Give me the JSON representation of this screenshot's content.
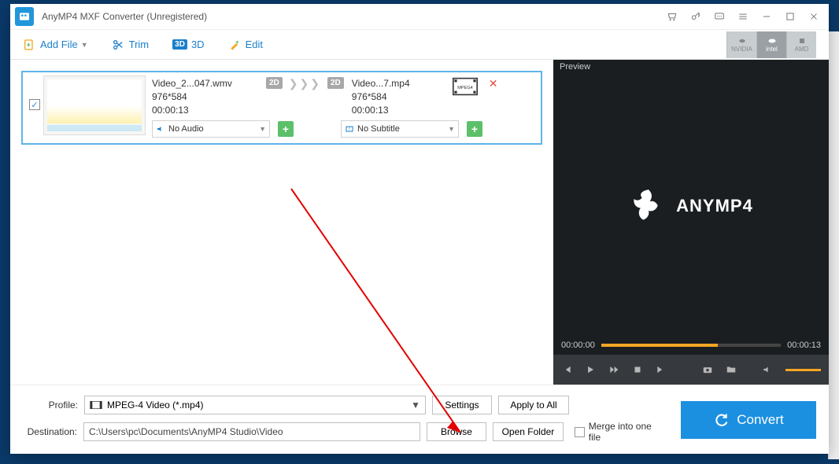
{
  "window": {
    "title": "AnyMP4 MXF Converter (Unregistered)"
  },
  "toolbar": {
    "add_file": "Add File",
    "trim": "Trim",
    "threeD": "3D",
    "edit": "Edit"
  },
  "gpu": {
    "nvidia": "NVIDIA",
    "intel": "intel",
    "amd": "AMD"
  },
  "item": {
    "source": {
      "name": "Video_2...047.wmv",
      "res": "976*584",
      "dur": "00:00:13"
    },
    "target": {
      "name": "Video...7.mp4",
      "res": "976*584",
      "dur": "00:00:13"
    },
    "badge_src": "2D",
    "badge_tgt": "2D",
    "audio_label": "No Audio",
    "subtitle_label": "No Subtitle"
  },
  "preview": {
    "header": "Preview",
    "brand": "ANYMP4",
    "time_start": "00:00:00",
    "time_end": "00:00:13"
  },
  "bottom": {
    "profile_label": "Profile:",
    "profile_value": "MPEG-4 Video (*.mp4)",
    "settings": "Settings",
    "apply_all": "Apply to All",
    "dest_label": "Destination:",
    "dest_value": "C:\\Users\\pc\\Documents\\AnyMP4 Studio\\Video",
    "browse": "Browse",
    "open_folder": "Open Folder",
    "merge": "Merge into one file",
    "convert": "Convert"
  }
}
